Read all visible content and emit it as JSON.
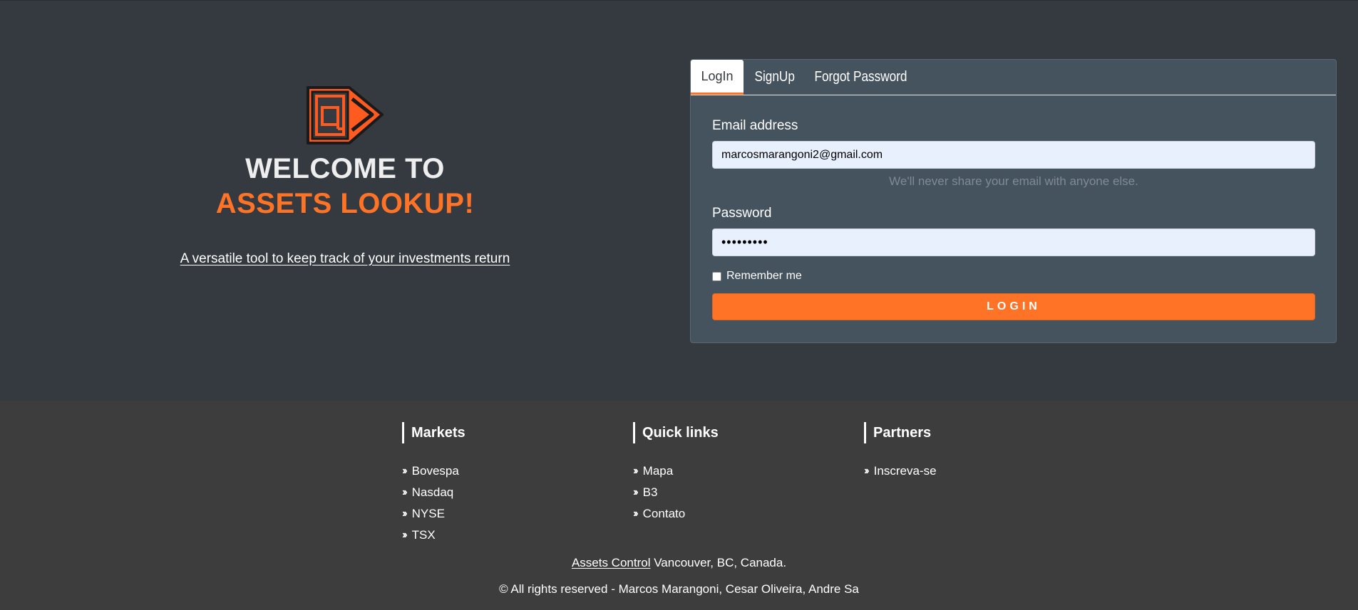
{
  "colors": {
    "accent": "#ff7326",
    "hero_bg": "#343a40",
    "card_bg": "#45535e",
    "footer_bg": "#3d3d3d"
  },
  "hero": {
    "logo_icon": "assets-at-tag-logo",
    "title_line1": "WELCOME TO",
    "title_line2": "ASSETS LOOKUP!",
    "tagline": "A versatile tool to keep track of your investments return"
  },
  "auth": {
    "tabs": [
      {
        "label": "LogIn",
        "active": true
      },
      {
        "label": "SignUp",
        "active": false
      },
      {
        "label": "Forgot Password",
        "active": false
      }
    ],
    "email_label": "Email address",
    "email_value": "marcosmarangoni2@gmail.com",
    "email_help": "We'll never share your email with anyone else.",
    "password_label": "Password",
    "password_value": "•••••••••",
    "remember_label": "Remember me",
    "login_button": "LOGIN"
  },
  "footer": {
    "columns": [
      {
        "heading": "Markets",
        "items": [
          "Bovespa",
          "Nasdaq",
          "NYSE",
          "TSX"
        ]
      },
      {
        "heading": "Quick links",
        "items": [
          "Mapa",
          "B3",
          "Contato"
        ]
      },
      {
        "heading": "Partners",
        "items": [
          "Inscreva-se"
        ]
      }
    ],
    "company_link": "Assets Control",
    "location": " Vancouver, BC, Canada.",
    "copyright": "© All rights reserved - Marcos Marangoni, Cesar Oliveira, Andre Sa"
  }
}
